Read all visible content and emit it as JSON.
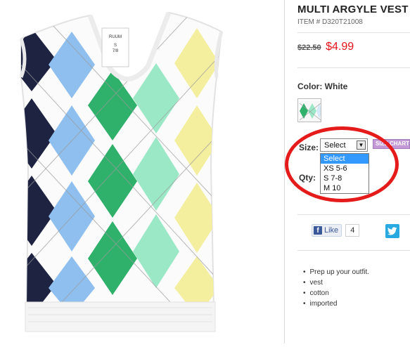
{
  "product": {
    "title": "MULTI ARGYLE VEST",
    "item_number": "ITEM # D320T21008",
    "old_price": "$22.50",
    "new_price": "$4.99",
    "color_label": "Color: White",
    "label_tag": {
      "brand": "RUUM",
      "size_s": "S",
      "size_num": "7/8"
    }
  },
  "size": {
    "label": "Size:",
    "selected": "Select",
    "options": [
      "Select",
      "XS 5-6",
      "S 7-8",
      "M 10"
    ],
    "size_chart_label": "SIZE CHART"
  },
  "qty": {
    "label": "Qty:"
  },
  "social": {
    "like_label": "Like",
    "like_count": "4"
  },
  "description": [
    "Prep up your outfit.",
    "vest",
    "cotton",
    "imported"
  ],
  "colors": {
    "price_red": "#e4121b",
    "highlight_circle": "#e51b1b",
    "navy": "#1d2341",
    "light_blue": "#8fbfee",
    "green": "#2fb06b",
    "mint": "#9be8c6",
    "yellow": "#f4ef9f",
    "facebook": "#3b5998",
    "twitter": "#29a9e1",
    "select_highlight": "#3399ff"
  },
  "icons": {
    "facebook": "facebook-icon",
    "twitter": "twitter-icon",
    "dropdown": "chevron-down-icon"
  }
}
